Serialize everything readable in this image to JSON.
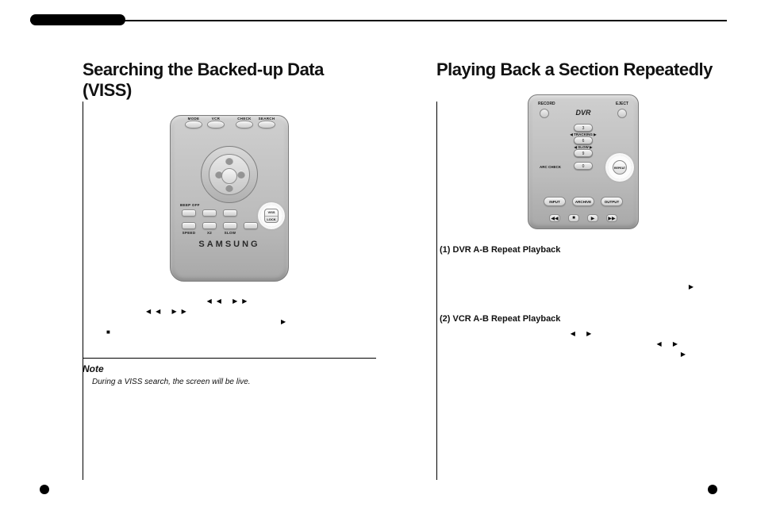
{
  "left": {
    "title": "Searching the Backed-up Data (VISS)",
    "remote": {
      "viss_label": "VISS",
      "lock_label": "LOCK",
      "beep_off": "BEEP OFF",
      "row3_labels": [
        "SPEED",
        "X2",
        "SLOW",
        ""
      ],
      "brand": "SAMSUNG",
      "top_labels": [
        "MODE",
        "VCR",
        "CHECK",
        "SEARCH"
      ]
    },
    "glyphs": {
      "r1": "◀◀  ▶▶",
      "r2": "◀◀     ▶▶",
      "r3": "▶",
      "r4": "■"
    },
    "note": {
      "title": "Note",
      "body": "During a VISS search, the screen will be live."
    }
  },
  "right": {
    "title": "Playing Back a Section Repeatedly",
    "remote": {
      "record": "RECORD",
      "eject": "EJECT",
      "dvr": "DVR",
      "mid1": "◀ TRACKING ▶",
      "mid2": "◀ SLOW ▶",
      "arc_check": "ARC CHECK",
      "repeat": "REPEAT",
      "bottom_labels": [
        "INPUT",
        "ARCHIVE",
        "OUTPUT"
      ],
      "transport": [
        "◀◀",
        "■",
        "▶",
        "▶▶"
      ]
    },
    "sub1": "(1) DVR A-B Repeat Playback",
    "sub2": "(2) VCR A-B Repeat Playback",
    "glyphs": {
      "g1": "▶",
      "g2": "◀ ▶",
      "g3": "◀  ▶",
      "g4": "▶"
    }
  }
}
